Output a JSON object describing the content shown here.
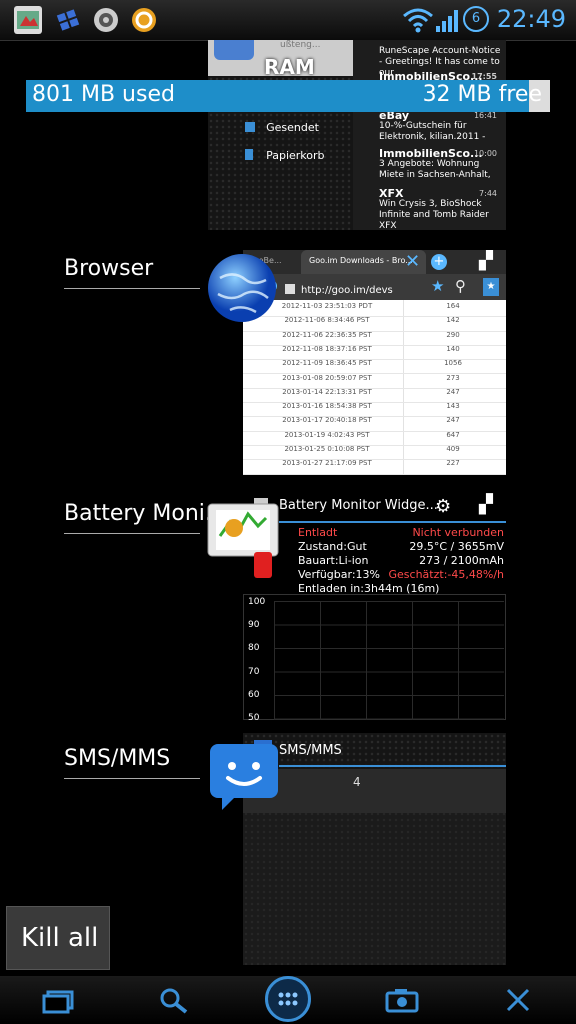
{
  "status_bar": {
    "time": "22:49",
    "battery_level": "6",
    "icons": [
      "app-icon",
      "windows-icon",
      "settings-icon",
      "orange-app-icon",
      "wifi-icon",
      "signal-icon"
    ]
  },
  "ram": {
    "used_text": "801 MB used",
    "free_text": "32 MB free",
    "label": "RAM",
    "used_fraction": 0.96
  },
  "apps": [
    {
      "name": "Browser"
    },
    {
      "name": "Battery Moni.."
    },
    {
      "name": "SMS/MMS"
    }
  ],
  "mail_thumb": {
    "header_partial": "ußteng...",
    "folders": [
      "Gesendet",
      "Papierkorb"
    ],
    "messages": [
      {
        "sender": "",
        "text": "RuneScape Account-Notice - Greetings! It has come to our",
        "time": ""
      },
      {
        "sender": "ImmobilienSco...",
        "text": "",
        "time": "17:55"
      },
      {
        "sender": "eBay",
        "text": "10-%-Gutschein für Elektronik, kilian.2011 -",
        "time": "16:41"
      },
      {
        "sender": "ImmobilienSco...",
        "text": "3 Angebote: Wohnung Miete in Sachsen-Anhalt,",
        "time": "10:00"
      },
      {
        "sender": "XFX",
        "text": "Win Crysis 3, BioShock Infinite and Tomb Raider XFX",
        "time": "7:44"
      }
    ]
  },
  "browser_thumb": {
    "tab_left": "...eBe...",
    "tab_active": "Goo.im Downloads - Bro...",
    "url": "http://goo.im/devs",
    "rows": [
      {
        "date": "2012-11-03 23:51:03 PDT",
        "n": "164"
      },
      {
        "date": "2012-11-06 8:34:46 PST",
        "n": "142"
      },
      {
        "date": "2012-11-06 22:36:35 PST",
        "n": "290"
      },
      {
        "date": "2012-11-08 18:37:16 PST",
        "n": "140"
      },
      {
        "date": "2012-11-09 18:36:45 PST",
        "n": "1056"
      },
      {
        "date": "2013-01-08 20:59:07 PST",
        "n": "273"
      },
      {
        "date": "2013-01-14 22:13:31 PST",
        "n": "247"
      },
      {
        "date": "2013-01-16 18:54:38 PST",
        "n": "143"
      },
      {
        "date": "2013-01-17 20:40:18 PST",
        "n": "247"
      },
      {
        "date": "2013-01-19 4:02:43 PST",
        "n": "647"
      },
      {
        "date": "2013-01-25 0:10:08 PST",
        "n": "409"
      },
      {
        "date": "2013-01-27 21:17:09 PST",
        "n": "227"
      }
    ]
  },
  "battery_thumb": {
    "title": "Battery Monitor Widge...",
    "rows": [
      {
        "left": "Entladt",
        "right": "Nicht verbunden",
        "left_red": true,
        "right_red": true
      },
      {
        "left": "Zustand:Gut",
        "right": "29.5°C / 3655mV",
        "left_red": false,
        "right_red": false
      },
      {
        "left": "Bauart:Li-ion",
        "right": "273 / 2100mAh",
        "left_red": false,
        "right_red": false
      },
      {
        "left": "Verfügbar:13%",
        "right": "Geschätzt:-45,48%/h",
        "left_red": false,
        "right_red": true
      },
      {
        "left": "Entladen in:3h44m (16m)",
        "right": "",
        "left_red": false,
        "right_red": false
      }
    ],
    "graph_labels": [
      "100",
      "90",
      "80",
      "70",
      "60",
      "50"
    ]
  },
  "sms_thumb": {
    "title": "SMS/MMS",
    "count": "4"
  },
  "kill_all": "Kill all",
  "navbar": [
    "recent-apps-icon",
    "search-icon",
    "app-drawer-icon",
    "camera-icon",
    "close-icon"
  ]
}
